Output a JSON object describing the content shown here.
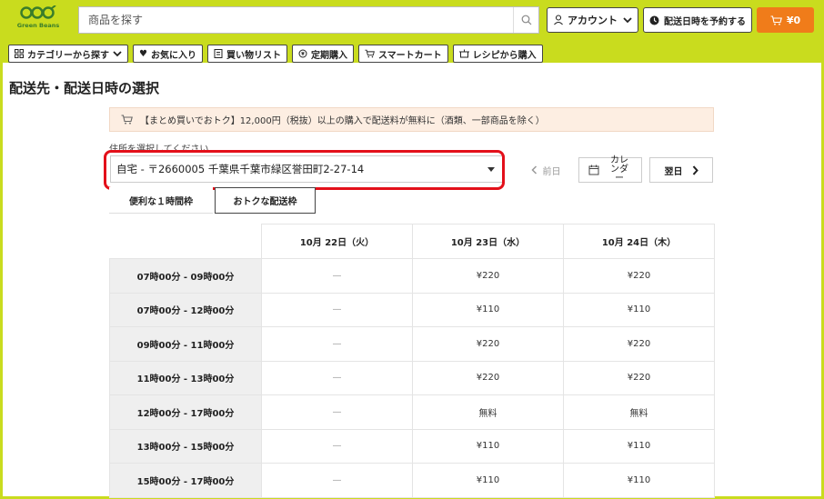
{
  "header": {
    "logo_text": "Green Beans",
    "search_placeholder": "商品を探す",
    "account_label": "アカウント",
    "delivery_label": "配送日時を予約する",
    "cart_label": "¥0"
  },
  "nav": [
    {
      "label": "カテゴリーから探す"
    },
    {
      "label": "お気に入り"
    },
    {
      "label": "買い物リスト"
    },
    {
      "label": "定期購入"
    },
    {
      "label": "スマートカート"
    },
    {
      "label": "レシピから購入"
    }
  ],
  "page": {
    "title": "配送先・配送日時の選択",
    "notice": "【まとめ買いでおトク】12,000円（税抜）以上の購入で配送料が無料に（酒類、一部商品を除く）",
    "address_label": "住所を選択してください",
    "address_value": "自宅 - 〒2660005 千葉県千葉市緑区誉田町2-27-14"
  },
  "day_nav": {
    "prev": "前日",
    "calendar": "カレンダー",
    "next": "翌日"
  },
  "tabs": [
    {
      "label": "便利な１時間枠"
    },
    {
      "label": "おトクな配送枠"
    }
  ],
  "table": {
    "columns": [
      "10月 22日（火）",
      "10月 23日（水）",
      "10月 24日（木）"
    ],
    "rows": [
      {
        "slot": "07時00分 - 09時00分",
        "cells": [
          "—",
          "¥220",
          "¥220"
        ]
      },
      {
        "slot": "07時00分 - 12時00分",
        "cells": [
          "—",
          "¥110",
          "¥110"
        ]
      },
      {
        "slot": "09時00分 - 11時00分",
        "cells": [
          "—",
          "¥220",
          "¥220"
        ]
      },
      {
        "slot": "11時00分 - 13時00分",
        "cells": [
          "—",
          "¥220",
          "¥220"
        ]
      },
      {
        "slot": "12時00分 - 17時00分",
        "cells": [
          "—",
          "無料",
          "無料"
        ]
      },
      {
        "slot": "13時00分 - 15時00分",
        "cells": [
          "—",
          "¥110",
          "¥110"
        ]
      },
      {
        "slot": "15時00分 - 17時00分",
        "cells": [
          "—",
          "¥110",
          "¥110"
        ]
      }
    ]
  },
  "colors": {
    "header_bg": "#c9dc1e",
    "cart_bg": "#f07c1a",
    "notice_bg": "#fdeee2",
    "highlight": "#e3101a",
    "delivery_icon": "#3a7d2a"
  },
  "icons": {
    "search": "search-icon",
    "account": "person-icon",
    "delivery": "clock-icon",
    "cart": "cart-icon",
    "category": "grid-icon",
    "favorite": "heart-icon",
    "list": "list-icon",
    "subscription": "cycle-icon",
    "smart_cart": "cart-icon",
    "recipe": "pot-icon",
    "calendar": "calendar-icon"
  }
}
